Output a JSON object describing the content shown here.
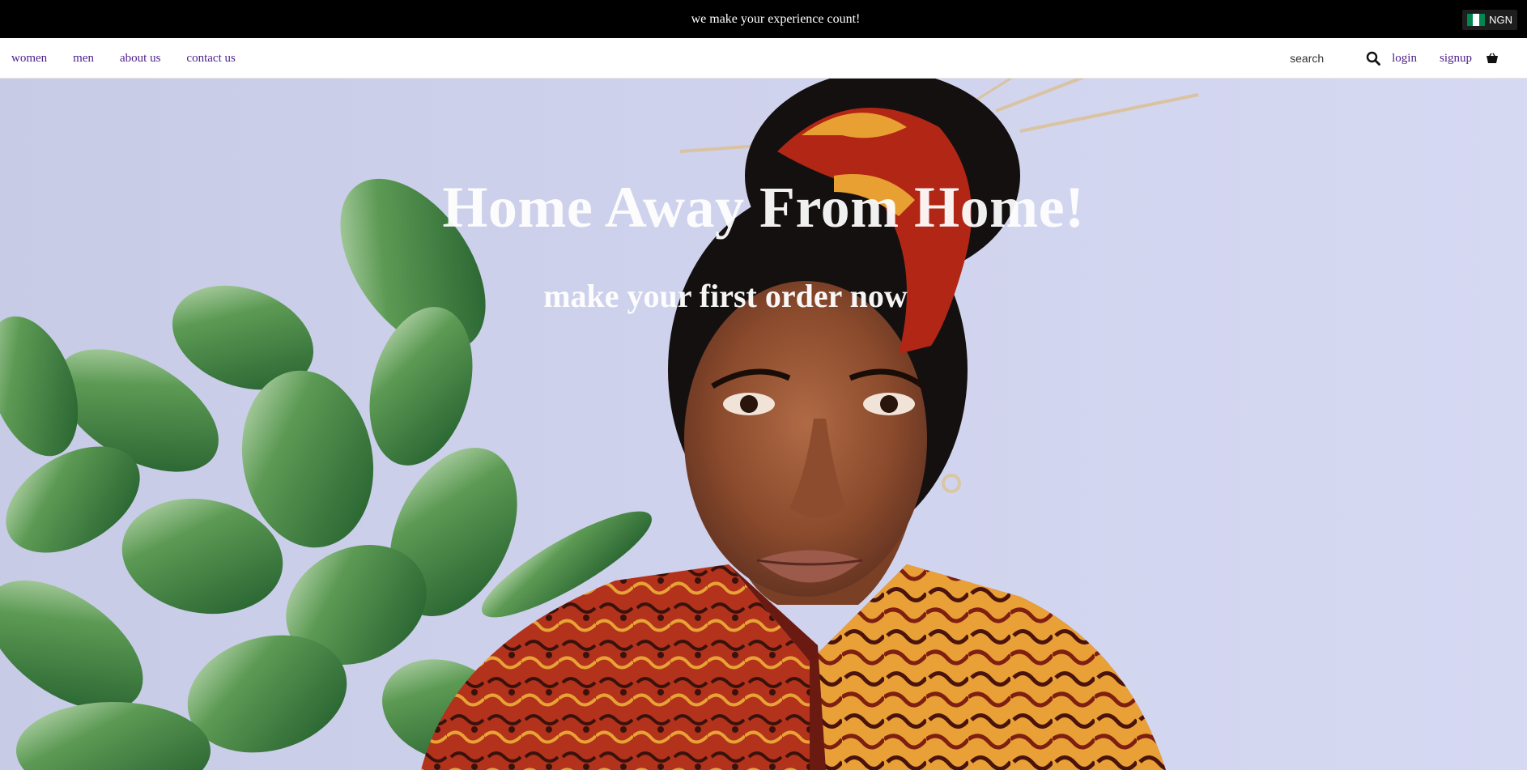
{
  "announcement": {
    "text": "we make your experience count!",
    "currency": {
      "code": "NGN",
      "flag_icon": "nigeria-flag-icon",
      "flag_colors": [
        "#008751",
        "#ffffff",
        "#008751"
      ]
    }
  },
  "nav": {
    "left_links": [
      {
        "label": "women"
      },
      {
        "label": "men"
      },
      {
        "label": "about us"
      },
      {
        "label": "contact us"
      }
    ],
    "search": {
      "placeholder": "search",
      "icon": "search-icon"
    },
    "login_label": "login",
    "signup_label": "signup",
    "cart_icon": "cart-icon"
  },
  "hero": {
    "title": "Home Away From Home!",
    "subtitle": "make your first order now",
    "image": "model-in-ankara-print-with-plant"
  },
  "colors": {
    "announcement_bg": "#000000",
    "nav_link": "#4b1f8c",
    "hero_text": "#ffffff"
  }
}
